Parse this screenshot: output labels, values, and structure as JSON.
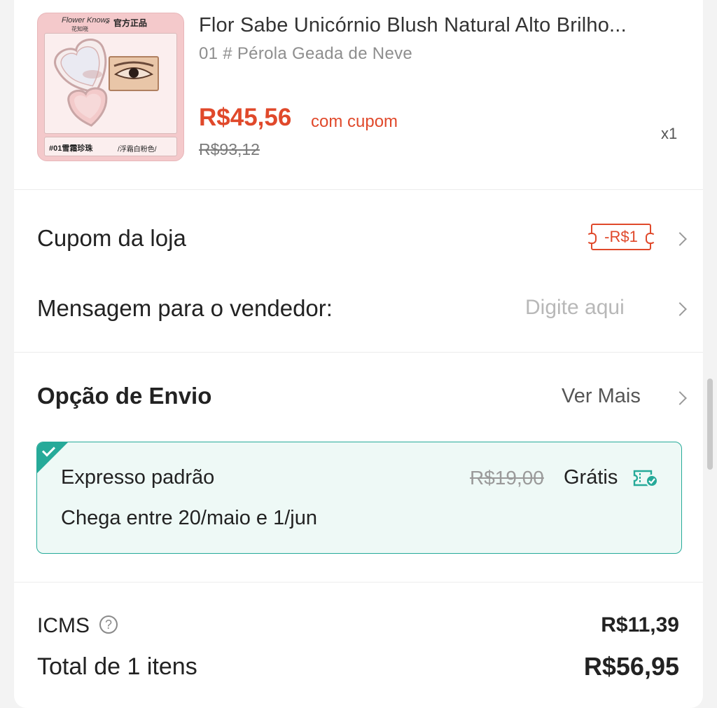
{
  "product": {
    "title": "Flor Sabe Unicórnio Blush Natural Alto Brilho...",
    "variant": "01 # Pérola Geada de Neve",
    "price": "R$45,56",
    "price_note": "com cupom",
    "original_price": "R$93,12",
    "quantity": "x1",
    "image": {
      "brand": "Flower Knows",
      "brand_cn": "花知晓",
      "cross": "×",
      "official": "官方正品",
      "shade_code": "#01雪霜珍珠",
      "shade_name": "/浮霜白粉色/"
    }
  },
  "store_coupon": {
    "label": "Cupom da loja",
    "value": "-R$1"
  },
  "message": {
    "label": "Mensagem para o vendedor:",
    "placeholder": "Digite aqui"
  },
  "shipping": {
    "title": "Opção de Envio",
    "more": "Ver Mais",
    "option": {
      "name": "Expresso padrão",
      "delivery": "Chega entre 20/maio e 1/jun",
      "original_cost": "R$19,00",
      "cost": "Grátis"
    },
    "accent_color": "#26aa99"
  },
  "summary": {
    "icms_label": "ICMS",
    "icms_help": "?",
    "icms_value": "R$11,39",
    "total_label": "Total de 1 itens",
    "total_value": "R$56,95"
  },
  "colors": {
    "price": "#e0492b",
    "background": "#f3f3f3"
  }
}
